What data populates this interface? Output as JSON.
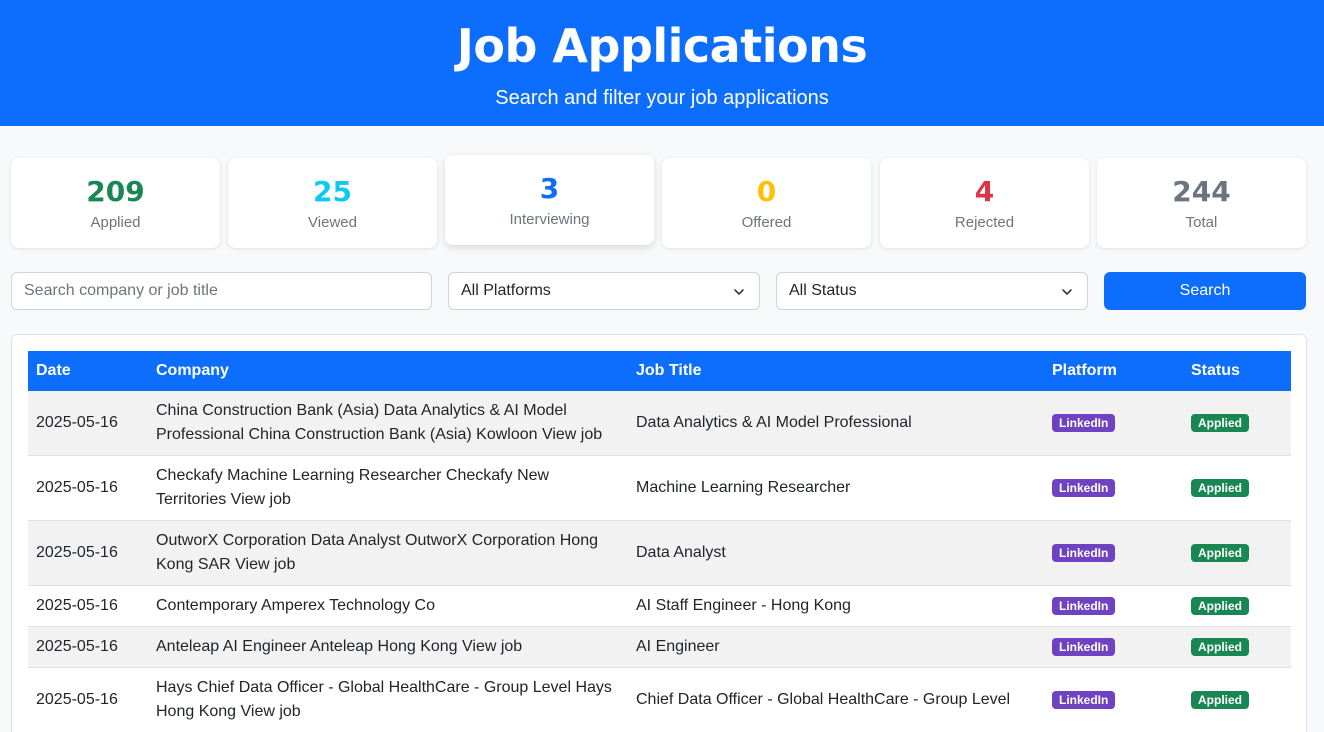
{
  "header": {
    "title": "Job Applications",
    "subtitle": "Search and filter your job applications"
  },
  "stats": [
    {
      "value": "209",
      "label": "Applied",
      "color": "#198754"
    },
    {
      "value": "25",
      "label": "Viewed",
      "color": "#0dcaf0"
    },
    {
      "value": "3",
      "label": "Interviewing",
      "color": "#0d6efd"
    },
    {
      "value": "0",
      "label": "Offered",
      "color": "#ffc107"
    },
    {
      "value": "4",
      "label": "Rejected",
      "color": "#dc3545"
    },
    {
      "value": "244",
      "label": "Total",
      "color": "#6c757d"
    }
  ],
  "filters": {
    "search_placeholder": "Search company or job title",
    "platform_selected": "All Platforms",
    "status_selected": "All Status",
    "search_button": "Search"
  },
  "table": {
    "headers": {
      "date": "Date",
      "company": "Company",
      "job_title": "Job Title",
      "platform": "Platform",
      "status": "Status"
    },
    "rows": [
      {
        "date": "2025-05-16",
        "company": "China Construction Bank (Asia) Data Analytics & AI Model Professional China Construction Bank (Asia) Kowloon View job",
        "job_title": "Data Analytics & AI Model Professional",
        "platform": "LinkedIn",
        "status": "Applied"
      },
      {
        "date": "2025-05-16",
        "company": "Checkafy Machine Learning Researcher Checkafy New Territories View job",
        "job_title": "Machine Learning Researcher",
        "platform": "LinkedIn",
        "status": "Applied"
      },
      {
        "date": "2025-05-16",
        "company": "OutworX Corporation Data Analyst OutworX Corporation Hong Kong SAR View job",
        "job_title": "Data Analyst",
        "platform": "LinkedIn",
        "status": "Applied"
      },
      {
        "date": "2025-05-16",
        "company": "Contemporary Amperex Technology Co",
        "job_title": "AI Staff Engineer - Hong Kong",
        "platform": "LinkedIn",
        "status": "Applied"
      },
      {
        "date": "2025-05-16",
        "company": "Anteleap AI Engineer Anteleap Hong Kong View job",
        "job_title": "AI Engineer",
        "platform": "LinkedIn",
        "status": "Applied"
      },
      {
        "date": "2025-05-16",
        "company": "Hays Chief Data Officer - Global HealthCare - Group Level Hays Hong Kong View job",
        "job_title": "Chief Data Officer - Global HealthCare - Group Level",
        "platform": "LinkedIn",
        "status": "Applied"
      }
    ]
  },
  "colors": {
    "primary": "#0d6efd",
    "platform_badge": "#6f42c1",
    "status_badge": "#198754"
  }
}
